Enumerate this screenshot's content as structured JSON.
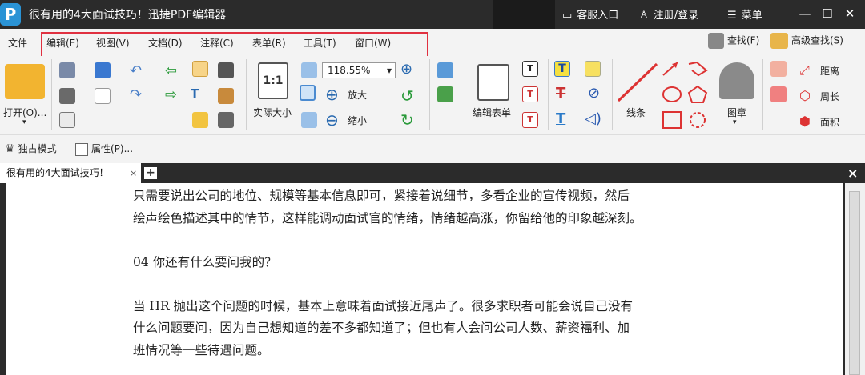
{
  "window": {
    "logo": "P",
    "title": "很有用的4大面试技巧！迅捷PDF编辑器",
    "service": "客服入口",
    "login": "注册/登录",
    "menu": "菜单",
    "min_icon": "minimize-icon",
    "max_icon": "maximize-icon",
    "close_icon": "close-icon"
  },
  "menu": {
    "file": "文件",
    "items": [
      "编辑(E)",
      "视图(V)",
      "文档(D)",
      "注释(C)",
      "表单(R)",
      "工具(T)",
      "窗口(W)"
    ],
    "find": "查找(F)",
    "advanced_find": "高级查找(S)"
  },
  "toolbar": {
    "open": "打开(O)...",
    "zoom": "118.55%",
    "actual_size": "实际大小",
    "zoom_in": "放大",
    "zoom_out": "缩小",
    "edit_form": "编辑表单",
    "line": "线条",
    "stamp": "图章",
    "distance": "距离",
    "perimeter": "周长",
    "area": "面积"
  },
  "subtoolbar": {
    "exclusive": "独占模式",
    "properties": "属性(P)..."
  },
  "tabs": {
    "active": "很有用的4大面试技巧！",
    "close": "×",
    "add": "+",
    "close_all": "×"
  },
  "document": {
    "lines": [
      "只需要说出公司的地位、规模等基本信息即可，紧接着说细节，多看企业的宣传视频，然后",
      "绘声绘色描述其中的情节，这样能调动面试官的情绪，情绪越高涨，你留给他的印象越深刻。",
      "04 你还有什么要问我的？",
      "当 HR 抛出这个问题的时候，基本上意味着面试接近尾声了。很多求职者可能会说自己没有",
      "什么问题要问，因为自己想知道的差不多都知道了；但也有人会问公司人数、薪资福利、加",
      "班情况等一些待遇问题。"
    ]
  },
  "colors": {
    "titlebar": "#2b2b2b",
    "accent": "#2a93d5",
    "highlight_box": "#e03040"
  }
}
